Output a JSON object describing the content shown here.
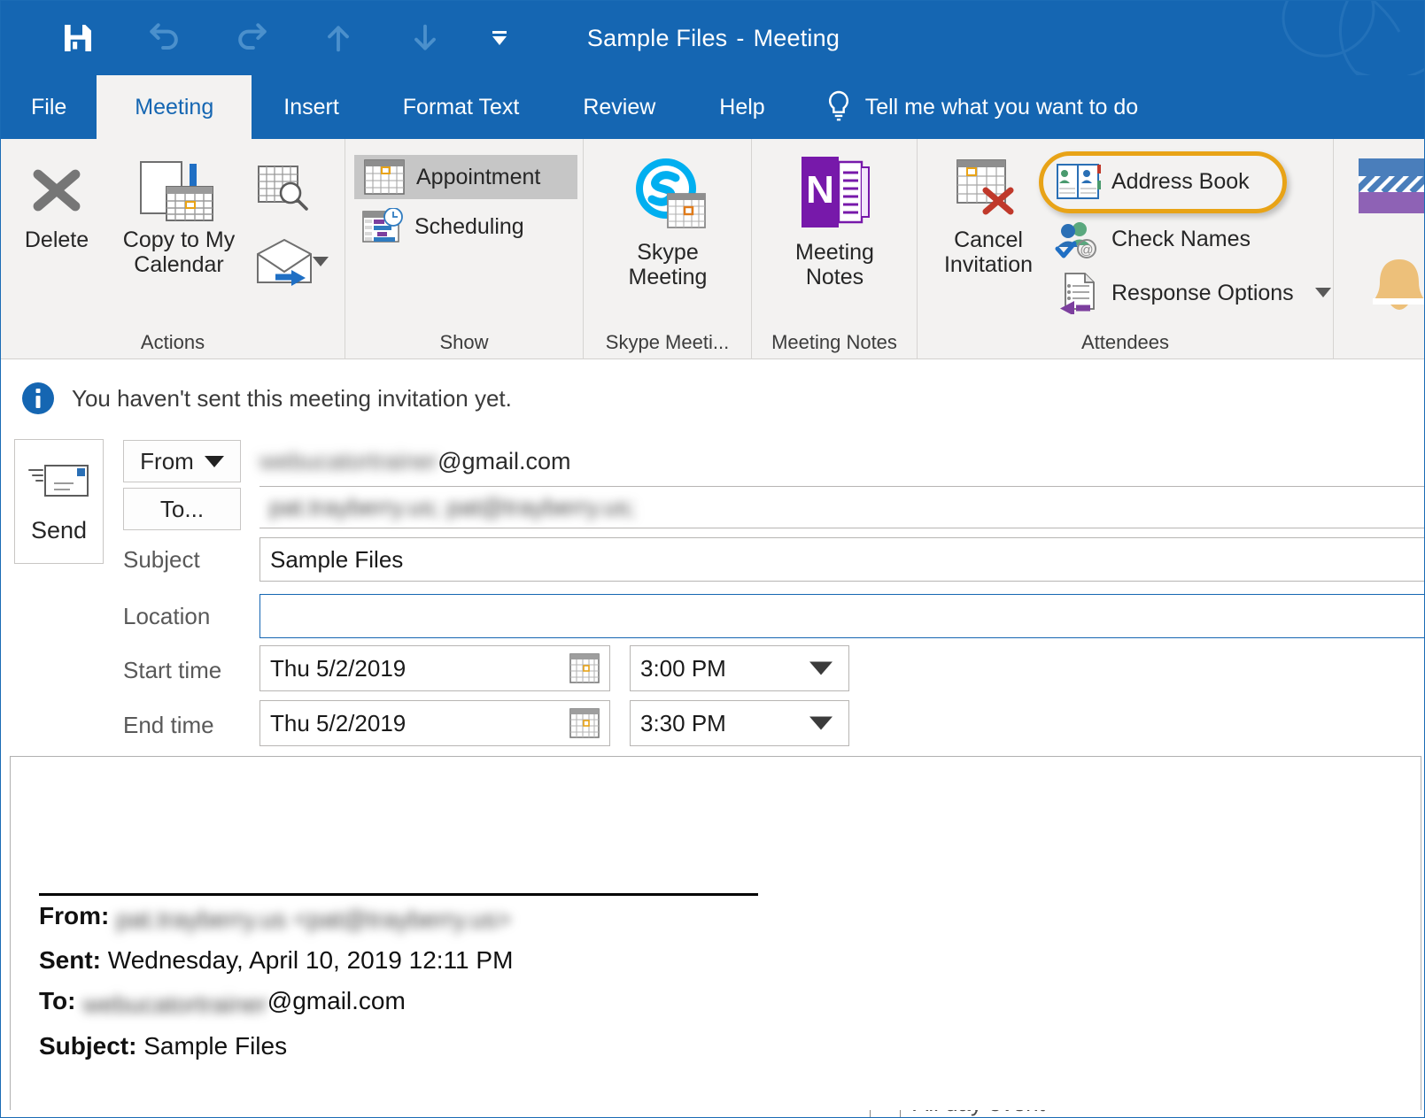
{
  "window": {
    "title_main": "Sample Files",
    "title_sep": "-",
    "title_type": "Meeting"
  },
  "quick_access": [
    {
      "name": "save-icon",
      "label": "Save",
      "enabled": true
    },
    {
      "name": "undo-icon",
      "label": "Undo",
      "enabled": false
    },
    {
      "name": "redo-icon",
      "label": "Redo",
      "enabled": false
    },
    {
      "name": "previous-item-icon",
      "label": "Previous Item",
      "enabled": false
    },
    {
      "name": "next-item-icon",
      "label": "Next Item",
      "enabled": false
    },
    {
      "name": "customize-quick-access-toolbar-icon",
      "label": "Customize Quick Access Toolbar",
      "enabled": true
    }
  ],
  "tabs": [
    {
      "label": "File",
      "active": false
    },
    {
      "label": "Meeting",
      "active": true
    },
    {
      "label": "Insert",
      "active": false
    },
    {
      "label": "Format Text",
      "active": false
    },
    {
      "label": "Review",
      "active": false
    },
    {
      "label": "Help",
      "active": false
    }
  ],
  "tell_me": {
    "label": "Tell me what you want to do"
  },
  "ribbon": {
    "groups": [
      {
        "label": "Actions"
      },
      {
        "label": "Show"
      },
      {
        "label": "Skype Meeti..."
      },
      {
        "label": "Meeting Notes"
      },
      {
        "label": "Attendees"
      },
      {
        "label": ""
      }
    ],
    "actions": {
      "delete": "Delete",
      "copy_to_my_calendar": "Copy to My\nCalendar",
      "copy_line1": "Copy to My",
      "copy_line2": "Calendar",
      "forward": "Forward"
    },
    "show": {
      "appointment": "Appointment",
      "scheduling": "Scheduling",
      "appointment_selected": true
    },
    "skype": {
      "line1": "Skype",
      "line2": "Meeting"
    },
    "meeting_notes": {
      "line1": "Meeting",
      "line2": "Notes"
    },
    "attendees": {
      "cancel_line1": "Cancel",
      "cancel_line2": "Invitation",
      "address_book": "Address Book",
      "check_names": "Check Names",
      "response_options": "Response Options",
      "highlighted": "Address Book",
      "highlight_color": "#e8a317"
    }
  },
  "info_bar": {
    "message": "You haven't sent this meeting invitation yet.",
    "icon": "info-icon",
    "icon_color": "#1566b2"
  },
  "form": {
    "send_label": "Send",
    "from_label": "From",
    "from_value_redacted": "webucatortrainer",
    "from_value_visible": "@gmail.com",
    "to_label": "To...",
    "to_value_redacted": "pat.trayberry.us; pat@trayberry.us;",
    "subject_label": "Subject",
    "subject_value": "Sample Files",
    "location_label": "Location",
    "location_value": "",
    "start_time_label": "Start time",
    "start_date": "Thu 5/2/2019",
    "start_clock": "3:00 PM",
    "end_time_label": "End time",
    "end_date": "Thu 5/2/2019",
    "end_clock": "3:30 PM",
    "all_day_label": "All day event",
    "all_day_checked": false
  },
  "body": {
    "from_label": "From:",
    "from_value_redacted": "pat.trayberry.us <pat@trayberry.us>",
    "sent_label": "Sent:",
    "sent_value": "Wednesday, April 10, 2019 12:11 PM",
    "to_label": "To:",
    "to_value_redacted": "webucatortrainer",
    "to_value_visible": "@gmail.com",
    "subject_label": "Subject:",
    "subject_value": "Sample Files"
  },
  "colors": {
    "title_bar": "#1566b2",
    "ribbon_bg": "#f3f2f1",
    "accent_blue": "#1566b2",
    "highlight_orange": "#e8a317"
  }
}
